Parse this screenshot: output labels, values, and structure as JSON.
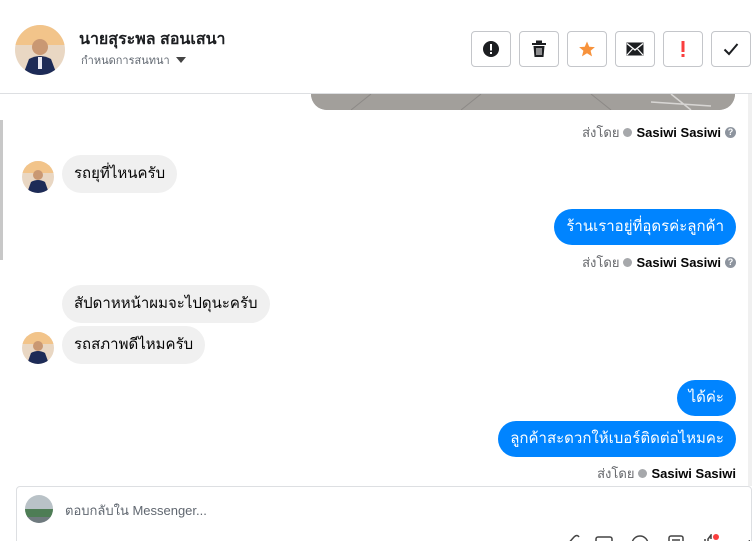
{
  "header": {
    "contact_name": "นายสุระพล สอนเสนา",
    "subtitle": "กำหนดการสนทนา"
  },
  "toolbar": {
    "buttons": [
      {
        "name": "report",
        "icon": "exclamation-circle-icon"
      },
      {
        "name": "delete",
        "icon": "trash-icon"
      },
      {
        "name": "star",
        "icon": "star-icon",
        "color": "#f7923b"
      },
      {
        "name": "email",
        "icon": "envelope-icon"
      },
      {
        "name": "mark-spam",
        "icon": "exclamation-icon",
        "color": "#fa3e3e"
      },
      {
        "name": "mark-done",
        "icon": "check-icon"
      }
    ]
  },
  "conversation": {
    "sent_by_label": "ส่งโดย",
    "sender": "Sasiwi Sasiwi",
    "messages": [
      {
        "direction": "in",
        "text": "รถยุที่ไหนครับ"
      },
      {
        "direction": "out",
        "text": "ร้านเราอยู่ที่อุดรค่ะลูกค้า"
      },
      {
        "direction": "in",
        "text": "สัปดาหหน้าผมจะไปดุนะครับ"
      },
      {
        "direction": "in",
        "text": "รถสภาพดีไหมครับ"
      },
      {
        "direction": "out",
        "text": "ได้ค่ะ"
      },
      {
        "direction": "out",
        "text": "ลูกค้าสะดวกให้เบอร์ติดต่อไหมคะ"
      }
    ]
  },
  "composer": {
    "placeholder": "ตอบกลับใน Messenger..."
  },
  "colors": {
    "outgoing_bubble": "#0084ff",
    "incoming_bubble": "#f0f0f0",
    "star": "#f7923b",
    "alert": "#fa3e3e"
  }
}
